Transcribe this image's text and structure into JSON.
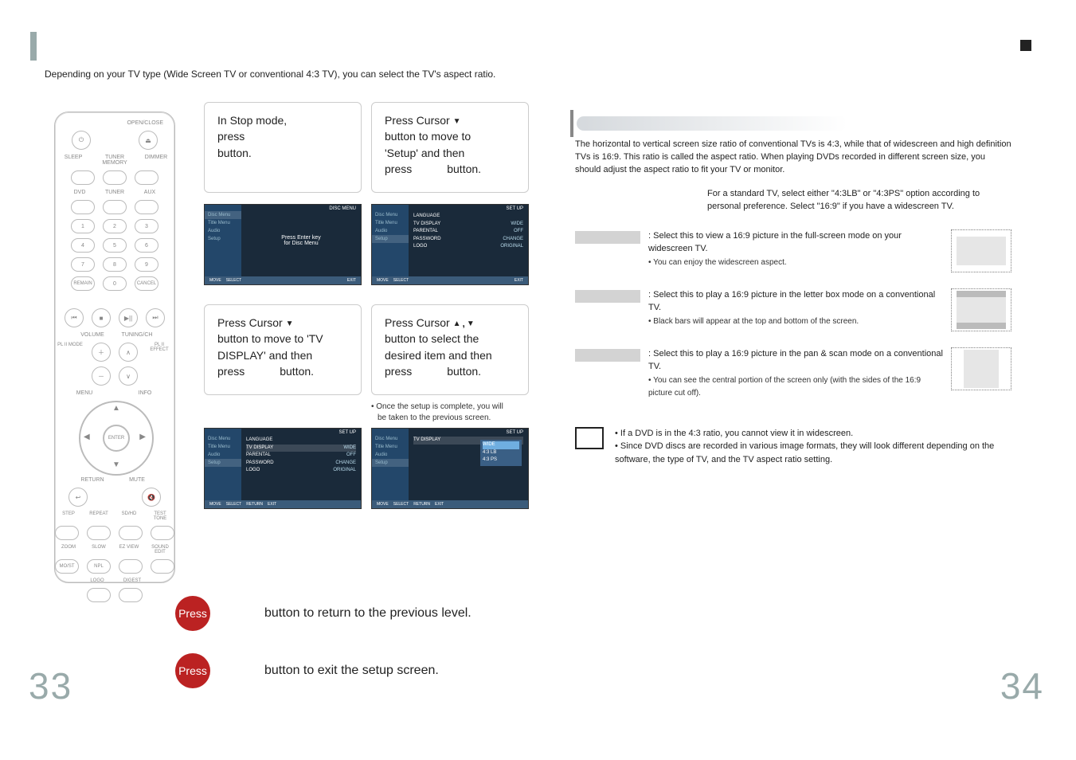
{
  "intro": "Depending on your TV type (Wide Screen TV or conventional 4:3 TV), you can select the TV's aspect ratio.",
  "page_left": "33",
  "page_right": "34",
  "remote": {
    "open_close": "OPEN/CLOSE",
    "sleep": "SLEEP",
    "tuner_mem": "TUNER MEMORY",
    "dimmer": "DIMMER",
    "dvd": "DVD",
    "tuner": "TUNER",
    "aux": "AUX",
    "nums": [
      "1",
      "2",
      "3",
      "4",
      "5",
      "6",
      "7",
      "8",
      "9",
      "0"
    ],
    "remain": "REMAIN",
    "cancel": "CANCEL",
    "volume": "VOLUME",
    "tuning": "TUNING/CH",
    "pl2_mode": "PL II MODE",
    "pl2_effect": "PL II EFFECT",
    "menu": "MENU",
    "info": "INFO",
    "enter": "ENTER",
    "return": "RETURN",
    "mute": "MUTE",
    "step": "STEP",
    "repeat": "REPEAT",
    "sd_hd": "SD/HD",
    "test": "TEST TONE",
    "zoom": "ZOOM",
    "slow": "SLOW",
    "ezview": "EZ VIEW",
    "sound_ed": "SOUND EDIT",
    "mo_st": "MO/ST",
    "npl": "NPL",
    "logo": "LOGO",
    "digest": "DIGEST"
  },
  "steps": {
    "s1": {
      "l1": "In Stop mode,",
      "l2": "press",
      "l3": "button."
    },
    "s2": {
      "l1": "Press Cursor",
      "l2": "button to move to",
      "l3": "'Setup' and then",
      "l4a": "press",
      "l4b": "button."
    },
    "s3": {
      "l1": "Press Cursor",
      "l2": "button to move to 'TV",
      "l3": "DISPLAY' and then",
      "l4a": "press",
      "l4b": "button."
    },
    "s4": {
      "l1": "Press Cursor",
      "l2": "button to select the",
      "l3": "desired item and then",
      "l4a": "press",
      "l4b": "button."
    },
    "s4_note_l1": "Once the setup is complete, you will",
    "s4_note_l2": "be taken to the previous screen."
  },
  "screens": {
    "side_items": [
      "Disc Menu",
      "Title Menu",
      "Audio",
      "Setup"
    ],
    "bottom_bar": [
      "MOVE",
      "SELECT",
      "RETURN",
      "EXIT"
    ],
    "top_discmenu": "DISC MENU",
    "top_setup": "SET UP",
    "center_msg_l1": "Press Enter key",
    "center_msg_l2": "for Disc Menu",
    "menu_items": [
      {
        "k": "LANGUAGE",
        "v": ""
      },
      {
        "k": "TV DISPLAY",
        "v": "WIDE"
      },
      {
        "k": "PARENTAL",
        "v": "OFF"
      },
      {
        "k": "PASSWORD",
        "v": "CHANGE"
      },
      {
        "k": "LOGO",
        "v": "ORIGINAL"
      }
    ],
    "popup": {
      "label": "TV DISPLAY",
      "items": [
        "WIDE",
        "4:3 LB",
        "4:3 PS"
      ]
    }
  },
  "explain": {
    "para": "The horizontal to vertical screen size ratio of conventional TVs is 4:3, while that of widescreen and high definition TVs is 16:9. This ratio is called the aspect ratio. When playing DVDs recorded in different screen size, you should adjust the aspect ratio to fit your TV or monitor.",
    "hint": "For a standard TV, select either \"4:3LB\" or \"4:3PS\" option according to personal preference. Select \"16:9\" if you have a widescreen TV.",
    "options": [
      {
        "desc": "Select this to view a 16:9 picture in the full-screen mode on your widescreen TV.",
        "sub": "You can enjoy the widescreen aspect."
      },
      {
        "desc": "Select this to play a 16:9 picture in the letter box mode on a conventional TV.",
        "sub": "Black bars will appear at the top and bottom of the screen."
      },
      {
        "desc": "Select this to play a 16:9 picture in the pan & scan mode on a conventional TV.",
        "sub": "You can see the central portion of the screen only (with the sides of the 16:9 picture cut off)."
      }
    ],
    "note1": "If a DVD is in the 4:3 ratio, you cannot view it in widescreen.",
    "note2": "Since DVD discs are recorded in various image formats, they will look different depending on the software, the type of TV, and the TV aspect ratio setting."
  },
  "bottom": {
    "press": "Press",
    "line1": "button to return to the previous level.",
    "line2": "button to exit the setup screen."
  }
}
